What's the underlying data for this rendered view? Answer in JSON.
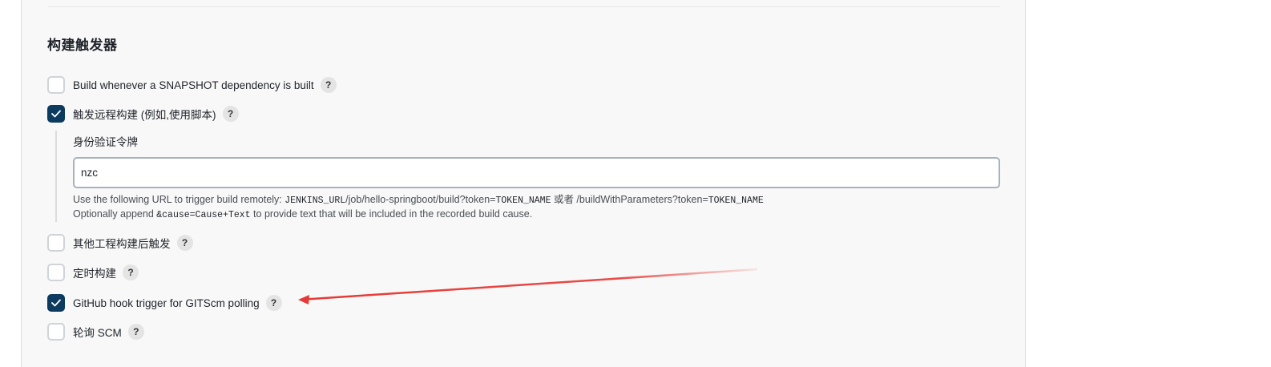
{
  "section": {
    "title": "构建触发器"
  },
  "triggers": [
    {
      "label": "Build whenever a SNAPSHOT dependency is built",
      "checked": false,
      "help": "?"
    },
    {
      "label": "触发远程构建 (例如,使用脚本)",
      "checked": true,
      "help": "?"
    },
    {
      "label": "其他工程构建后触发",
      "checked": false,
      "help": "?"
    },
    {
      "label": "定时构建",
      "checked": false,
      "help": "?"
    },
    {
      "label": "GitHub hook trigger for GITScm polling",
      "checked": true,
      "help": "?"
    },
    {
      "label": "轮询 SCM",
      "checked": false,
      "help": "?"
    }
  ],
  "remote": {
    "token_label": "身份验证令牌",
    "token_value": "nzc",
    "help1_prefix": "Use the following URL to trigger build remotely: ",
    "help1_code1": "JENKINS_URL",
    "help1_mid": "/job/hello-springboot/build?token=",
    "help1_code2": "TOKEN_NAME",
    "help1_or": " 或者 /buildWithParameters?token=",
    "help1_code3": "TOKEN_NAME",
    "help2_prefix": "Optionally append ",
    "help2_code": "&cause=Cause+Text",
    "help2_suffix": " to provide text that will be included in the recorded build cause."
  },
  "colors": {
    "checkbox_checked": "#0c3b5f",
    "arrow": "#e53935"
  }
}
